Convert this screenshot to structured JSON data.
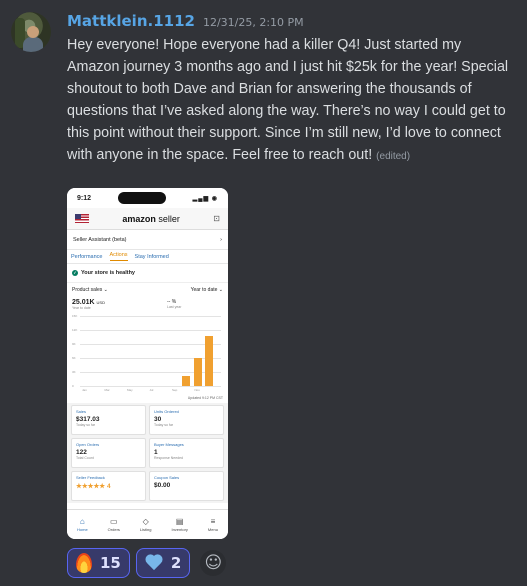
{
  "author": {
    "username": "Mattklein.1112",
    "timestamp": "12/31/25, 2:10 PM"
  },
  "message": {
    "text": "Hey everyone! Hope everyone had a killer Q4! Just started my Amazon journey 3 months ago and I just hit $25k for the year! Special shoutout to both Dave and Brian for answering the thousands of questions that I’ve asked along the way. There’s no way I could get to this point without their support. Since I’m still new, I’d love to connect with anyone in the space. Feel free to reach out!",
    "edited_label": "(edited)"
  },
  "attachment": {
    "status_time": "9:12",
    "status_icons": "▂▄▆ ◉",
    "brand_main": "amazon",
    "brand_sub": "seller",
    "assistant_label": "Seller Assistant (beta)",
    "tabs": [
      "Performance",
      "Actions",
      "Stay Informed"
    ],
    "active_tab_index": 1,
    "health_label": "Your store is healthy",
    "filter_left": "Product sales",
    "filter_right": "Year to date",
    "metric_value": "25.01K",
    "metric_unit": "USD",
    "metric_sub": "Year to date",
    "metric_right": "-- %",
    "metric_right_sub": "Last year",
    "chart_data": {
      "type": "bar",
      "categories": [
        "Jan",
        "Feb",
        "Mar",
        "Apr",
        "May",
        "Jun",
        "Jul",
        "Aug",
        "Sep",
        "Oct",
        "Nov",
        "Dec"
      ],
      "x_tick_labels": [
        "Jan",
        "Mar",
        "May",
        "Jul",
        "Sep",
        "Nov"
      ],
      "values": [
        0,
        0,
        0,
        0,
        0,
        0,
        0,
        0,
        0,
        2.2,
        6,
        10.8
      ],
      "y_tick_labels": [
        "0",
        "3K",
        "6K",
        "9K",
        "12K",
        "15K"
      ],
      "ylim": [
        0,
        15
      ]
    },
    "updated_label": "Updated 9:12 PM CST",
    "cards": [
      {
        "title": "Sales",
        "value": "$317.03",
        "sub": "Today so far"
      },
      {
        "title": "Units Ordered",
        "value": "30",
        "sub": "Today so far"
      },
      {
        "title": "Open Orders",
        "value": "122",
        "sub": "Total Count"
      },
      {
        "title": "Buyer Messages",
        "value": "1",
        "sub": "Response Needed"
      },
      {
        "title": "Seller Feedback",
        "value": "★★★★★ 4",
        "sub": ""
      },
      {
        "title": "Coupon Sales",
        "value": "$0.00",
        "sub": ""
      }
    ],
    "nav": [
      {
        "label": "Home",
        "icon": "⌂"
      },
      {
        "label": "Orders",
        "icon": "▭"
      },
      {
        "label": "Listing",
        "icon": "◇"
      },
      {
        "label": "Inventory",
        "icon": "▤"
      },
      {
        "label": "Menu",
        "icon": "≡"
      }
    ]
  },
  "reactions": [
    {
      "emoji": "fire-emoji",
      "count": "15"
    },
    {
      "emoji": "blue-heart-emoji",
      "count": "2"
    }
  ],
  "colors": {
    "background": "#313338",
    "username": "#57a5e5",
    "reaction_border": "#5865f2",
    "bar": "#f0a030"
  }
}
